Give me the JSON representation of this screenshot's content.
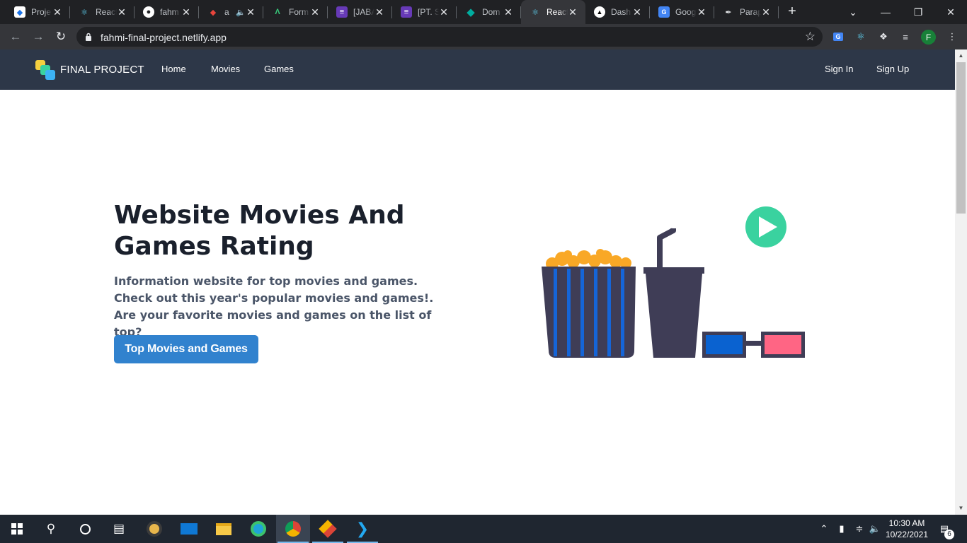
{
  "browser": {
    "tabs": [
      {
        "label": "Proje",
        "icon": "site-favicon-icon",
        "active": false
      },
      {
        "label": "React",
        "icon": "react-icon",
        "active": false
      },
      {
        "label": "fahm",
        "icon": "github-icon",
        "active": false
      },
      {
        "label": "a",
        "icon": "audio-site-icon",
        "active": false
      },
      {
        "label": "Form",
        "icon": "formik-icon",
        "active": false
      },
      {
        "label": "[JABA",
        "icon": "list-icon",
        "active": false
      },
      {
        "label": "[PT. S",
        "icon": "list-icon",
        "active": false
      },
      {
        "label": "Dom",
        "icon": "diamond-icon",
        "active": false
      },
      {
        "label": "React",
        "icon": "react-icon",
        "active": true
      },
      {
        "label": "Dash",
        "icon": "vercel-icon",
        "active": false
      },
      {
        "label": "Goog",
        "icon": "google-translate-icon",
        "active": false
      },
      {
        "label": "Parap",
        "icon": "feather-icon",
        "active": false
      }
    ],
    "url": "fahmi-final-project.netlify.app",
    "profile_initial": "F"
  },
  "site": {
    "brand": "FINAL PROJECT",
    "nav": {
      "home": "Home",
      "movies": "Movies",
      "games": "Games",
      "sign_in": "Sign In",
      "sign_up": "Sign Up"
    },
    "hero": {
      "title": "Website Movies And Games Rating",
      "description": "Information website for top movies and games. Check out this year's popular movies and games!. Are your favorite movies and games on the list of top?",
      "cta": "Top Movies and Games"
    },
    "colors": {
      "navbar": "#2d3748",
      "button": "#3182ce",
      "illustration_dark": "#3f3d56",
      "popcorn": "#f9a826",
      "stripe": "#1565d8",
      "play": "#3ad29f",
      "lens_blue": "#0a62d0",
      "lens_red": "#ff6584"
    }
  },
  "taskbar": {
    "time": "10:30 AM",
    "date": "10/22/2021",
    "notification_count": "6"
  }
}
